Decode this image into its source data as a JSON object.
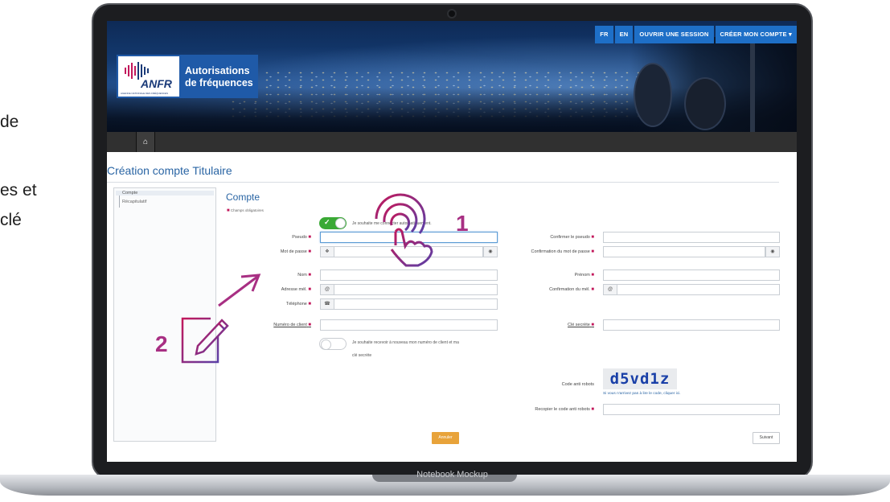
{
  "left_note": {
    "line1": "de",
    "line2": "es et",
    "line3": "clé"
  },
  "topnav": {
    "fr": "FR",
    "en": "EN",
    "login": "OUVRIR UNE SESSION",
    "create": "CRÉER MON COMPTE ▾"
  },
  "logo": {
    "name": "ANFR",
    "agency": "AGENCE NATIONALE DES FRÉQUENCES",
    "title_line1": "Autorisations",
    "title_line2": "de fréquences"
  },
  "page_title": "Création compte Titulaire",
  "sidebar": {
    "items": [
      "Compte",
      "Récapitulatif"
    ]
  },
  "form": {
    "title": "Compte",
    "required_note": "Champs obligatoires",
    "autologin_text": "Je souhaite me connecter automatiquement.",
    "left_labels": {
      "pseudo": "Pseudo",
      "password": "Mot de passe",
      "nom": "Nom",
      "email": "Adresse mél.",
      "phone": "Téléphone",
      "client": "Numéro de client"
    },
    "right_labels": {
      "confirm_pseudo": "Confirmer le pseudo",
      "confirm_password": "Confirmation du mot de passe",
      "prenom": "Prénom",
      "confirm_email": "Confirmation du mél.",
      "secret_key": "Clé secrète"
    },
    "resend_text_1": "Je souhaite recevoir à nouveau mon numéro de client et ma",
    "resend_text_2": "clé secrète",
    "captcha_label": "Code anti robots",
    "captcha_code": "d5vd1z",
    "captcha_help": "Si vous n'arrivez pas à lire le code, cliquer ici.",
    "captcha_retype_label": "Recopier le code anti robots",
    "cancel": "Annuler",
    "next": "Suivant"
  },
  "annotations": {
    "step1": "1",
    "step2": "2"
  },
  "mockup_label": "Notebook Mockup",
  "colors": {
    "accent_blue": "#1e6fc7",
    "required_dot": "#c2185b",
    "toggle_on": "#3aa935",
    "annotation": "#a82f83",
    "cancel_btn": "#e8a33a"
  }
}
